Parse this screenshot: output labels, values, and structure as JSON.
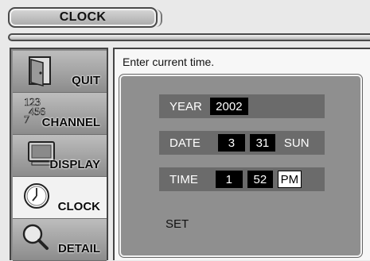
{
  "header": {
    "title": "CLOCK"
  },
  "sidebar": {
    "items": [
      {
        "label": "QUIT",
        "icon": "door-icon"
      },
      {
        "label": "CHANNEL",
        "icon": "channel-numbers-icon",
        "icon_text": "123456 7"
      },
      {
        "label": "DISPLAY",
        "icon": "monitor-icon"
      },
      {
        "label": "CLOCK",
        "icon": "clock-icon",
        "active": true
      },
      {
        "label": "DETAIL",
        "icon": "magnifier-icon"
      }
    ]
  },
  "main": {
    "instruction": "Enter current time.",
    "year": {
      "label": "YEAR",
      "value": "2002"
    },
    "date": {
      "label": "DATE",
      "month": "3",
      "day": "31",
      "weekday": "SUN"
    },
    "time": {
      "label": "TIME",
      "hour": "1",
      "minute": "52",
      "ampm": "PM"
    },
    "set_label": "SET"
  },
  "colors": {
    "panel": "#8f8f8f",
    "row": "#6b6b6b",
    "active_menu": "#f2f2f2"
  }
}
